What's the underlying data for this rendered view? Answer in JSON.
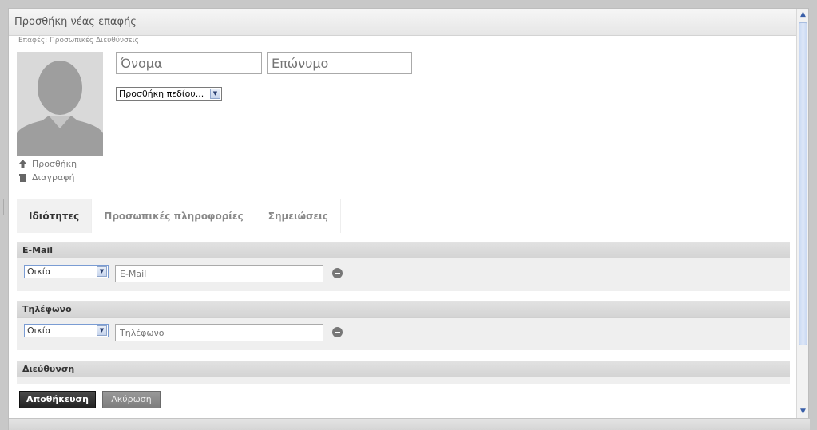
{
  "dialog": {
    "title": "Προσθήκη νέας επαφής",
    "breadcrumb": "Επαφές: Προσωπικές Διευθύνσεις"
  },
  "photo": {
    "add_label": "Προσθήκη",
    "delete_label": "Διαγραφή"
  },
  "name": {
    "first_placeholder": "Όνομα",
    "last_placeholder": "Επώνυμο"
  },
  "add_field": {
    "selected": "Προσθήκη πεδίου..."
  },
  "tabs": [
    {
      "label": "Ιδιότητες",
      "active": true
    },
    {
      "label": "Προσωπικές πληροφορίες",
      "active": false
    },
    {
      "label": "Σημειώσεις",
      "active": false
    }
  ],
  "sections": {
    "email": {
      "title": "E-Mail",
      "type_selected": "Οικία",
      "placeholder": "E-Mail"
    },
    "phone": {
      "title": "Τηλέφωνο",
      "type_selected": "Οικία",
      "placeholder": "Τηλέφωνο"
    },
    "address": {
      "title": "Διεύθυνση"
    }
  },
  "buttons": {
    "save": "Αποθήκευση",
    "cancel": "Ακύρωση"
  },
  "colors": {
    "save_bg": "#2b2b2b",
    "cancel_bg": "#8a8a8a",
    "active_tab_bg": "#f1f1f1",
    "section_header_bg": "#d9d9d9"
  },
  "icons": {
    "upload": "upload-arrow-icon",
    "delete": "trash-icon",
    "remove": "minus-circle-icon",
    "dropdown": "chevron-down-icon"
  }
}
